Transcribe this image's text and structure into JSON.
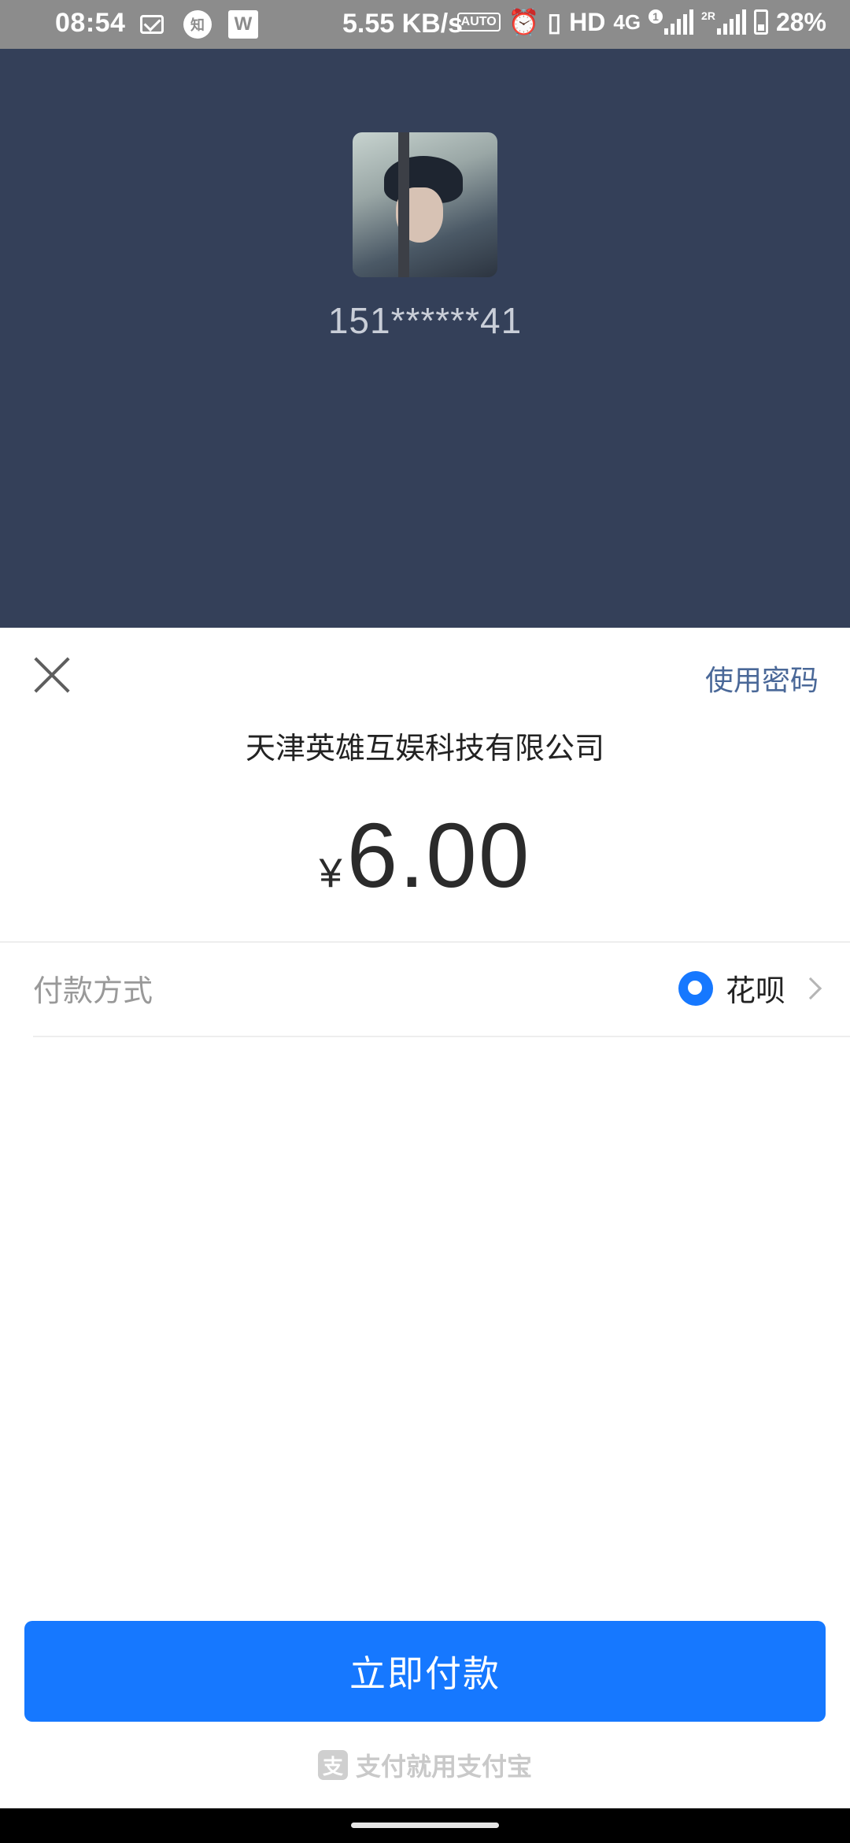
{
  "status_bar": {
    "time": "08:54",
    "zhi_label": "知",
    "wps_label": "W",
    "speed": "5.55 KB/s",
    "auto_label": "AUTO",
    "hd": "HD",
    "net": "4G",
    "sim1_label": "1",
    "sim2_label": "2R",
    "battery": "28%"
  },
  "header": {
    "phone": "151******41"
  },
  "sheet": {
    "use_password": "使用密码",
    "merchant": "天津英雄互娱科技有限公司",
    "currency": "¥",
    "amount": "6.00",
    "pay_method_label": "付款方式",
    "pay_method_value": "花呗"
  },
  "pay_button": "立即付款",
  "footer": {
    "logo_char": "支",
    "text": "支付就用支付宝"
  },
  "colors": {
    "header_bg": "#344059",
    "accent": "#1678ff",
    "link": "#4a6898"
  }
}
